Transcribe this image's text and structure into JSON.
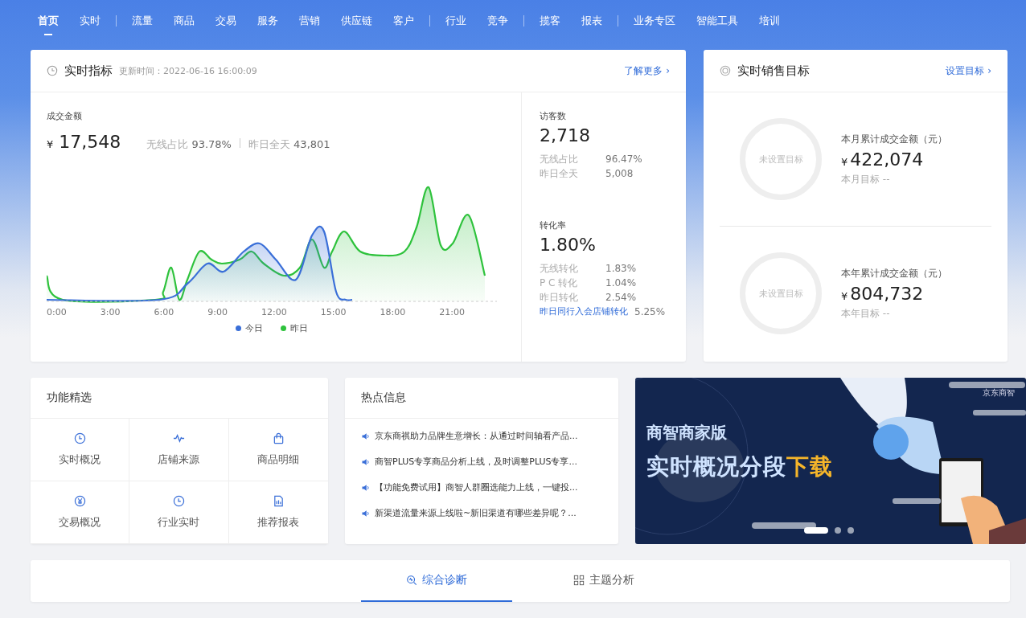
{
  "nav": [
    {
      "label": "首页",
      "selected": true,
      "divider_after": false
    },
    {
      "label": "实时",
      "selected": false,
      "divider_after": true
    },
    {
      "label": "流量",
      "selected": false,
      "divider_after": false
    },
    {
      "label": "商品",
      "selected": false,
      "divider_after": false
    },
    {
      "label": "交易",
      "selected": false,
      "divider_after": false
    },
    {
      "label": "服务",
      "selected": false,
      "divider_after": false
    },
    {
      "label": "营销",
      "selected": false,
      "divider_after": false
    },
    {
      "label": "供应链",
      "selected": false,
      "divider_after": false
    },
    {
      "label": "客户",
      "selected": false,
      "divider_after": true
    },
    {
      "label": "行业",
      "selected": false,
      "divider_after": false
    },
    {
      "label": "竞争",
      "selected": false,
      "divider_after": true
    },
    {
      "label": "揽客",
      "selected": false,
      "divider_after": false
    },
    {
      "label": "报表",
      "selected": false,
      "divider_after": true
    },
    {
      "label": "业务专区",
      "selected": false,
      "divider_after": false
    },
    {
      "label": "智能工具",
      "selected": false,
      "divider_after": false
    },
    {
      "label": "培训",
      "selected": false,
      "divider_after": false
    }
  ],
  "realtime": {
    "title": "实时指标",
    "updated": "更新时间：2022-06-16 16:00:09",
    "more": "了解更多",
    "more_arrow": "›",
    "sales": {
      "label": "成交金额",
      "currency": "¥",
      "value": "17,548",
      "wireless_label": "无线占比",
      "wireless": "93.78%",
      "yesterday_label": "昨日全天",
      "yesterday": "43,801"
    },
    "x_labels": [
      "0:00",
      "3:00",
      "6:00",
      "9:00",
      "12:00",
      "15:00",
      "18:00",
      "21:00"
    ],
    "legend": [
      {
        "label": "今日",
        "color": "#3a6fd8"
      },
      {
        "label": "昨日",
        "color": "#2ec23c"
      }
    ],
    "visitors": {
      "label": "访客数",
      "value": "2,718",
      "rows": [
        {
          "label": "无线占比",
          "value": "96.47%"
        },
        {
          "label": "昨日全天",
          "value": "5,008"
        }
      ]
    },
    "conversion": {
      "label": "转化率",
      "value": "1.80%",
      "rows": [
        {
          "label": "无线转化",
          "value": "1.83%"
        },
        {
          "label": "P C 转化",
          "value": "1.04%"
        },
        {
          "label": "昨日转化",
          "value": "2.54%"
        }
      ],
      "peer_link": "昨日同行入会店铺转化",
      "peer_value": "5.25%"
    }
  },
  "target": {
    "title": "实时销售目标",
    "link": "设置目标",
    "link_arrow": "›",
    "items": [
      {
        "ring": "未设置目标",
        "label": "本月累计成交金额（元）",
        "currency": "¥",
        "value": "422,074",
        "goal": "本月目标 --"
      },
      {
        "ring": "未设置目标",
        "label": "本年累计成交金额（元）",
        "currency": "¥",
        "value": "804,732",
        "goal": "本年目标 --"
      }
    ]
  },
  "features": {
    "title": "功能精选",
    "items": [
      {
        "label": "实时概况",
        "kind": "clock"
      },
      {
        "label": "店铺来源",
        "kind": "pulse"
      },
      {
        "label": "商品明细",
        "kind": "bag"
      },
      {
        "label": "交易概况",
        "kind": "yen"
      },
      {
        "label": "行业实时",
        "kind": "clock"
      },
      {
        "label": "推荐报表",
        "kind": "report"
      }
    ]
  },
  "news": {
    "title": "热点信息",
    "items": [
      "京东商祺助力品牌生意增长：从通过时间轴看产品...",
      "商智PLUS专享商品分析上线，及时调整PLUS专享...",
      "【功能免费试用】商智人群圈选能力上线，一键投...",
      "新渠道流量来源上线啦~新旧渠道有哪些差异呢？..."
    ]
  },
  "banner": {
    "brand": "京东商智",
    "subtitle": "商智商家版",
    "headline": "实时概况分段",
    "highlight": "下载",
    "dots": [
      {
        "selected": true
      },
      {
        "selected": false
      },
      {
        "selected": false
      }
    ]
  },
  "bottom_tabs": [
    {
      "label": "综合诊断",
      "kind": "diagnosis",
      "selected": true
    },
    {
      "label": "主题分析",
      "kind": "grid",
      "selected": false
    }
  ]
}
